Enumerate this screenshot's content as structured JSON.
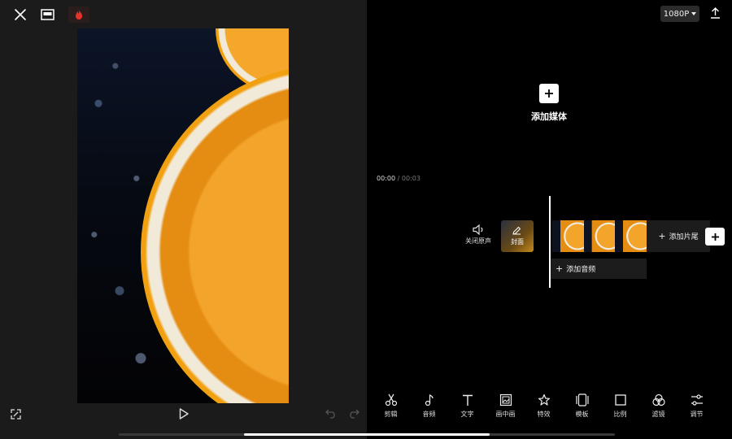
{
  "topbar": {
    "close_icon": "close-icon",
    "fullscreen_toggle_icon": "window-icon",
    "tag_icon": "flame-icon",
    "resolution": "1080P",
    "export_icon": "upload-icon"
  },
  "preview": {
    "play_icon": "play-icon",
    "expand_icon": "expand-icon",
    "undo_icon": "undo-icon",
    "redo_icon": "redo-icon"
  },
  "editor": {
    "add_media_label": "添加媒体",
    "timecode_current": "00:00",
    "timecode_total": "/ 00:03",
    "mute_label": "关闭原声",
    "cover_label": "封面",
    "add_ending_label": "添加片尾",
    "add_audio_label": "添加音频"
  },
  "toolbar": {
    "items": [
      {
        "label": "剪辑",
        "icon": "scissors-icon"
      },
      {
        "label": "音频",
        "icon": "music-note-icon"
      },
      {
        "label": "文字",
        "icon": "text-icon"
      },
      {
        "label": "画中画",
        "icon": "picture-in-picture-icon"
      },
      {
        "label": "特效",
        "icon": "sparkle-icon"
      },
      {
        "label": "模板",
        "icon": "template-icon"
      },
      {
        "label": "比例",
        "icon": "ratio-icon"
      },
      {
        "label": "滤镜",
        "icon": "filter-icon"
      },
      {
        "label": "调节",
        "icon": "adjust-icon"
      }
    ]
  }
}
